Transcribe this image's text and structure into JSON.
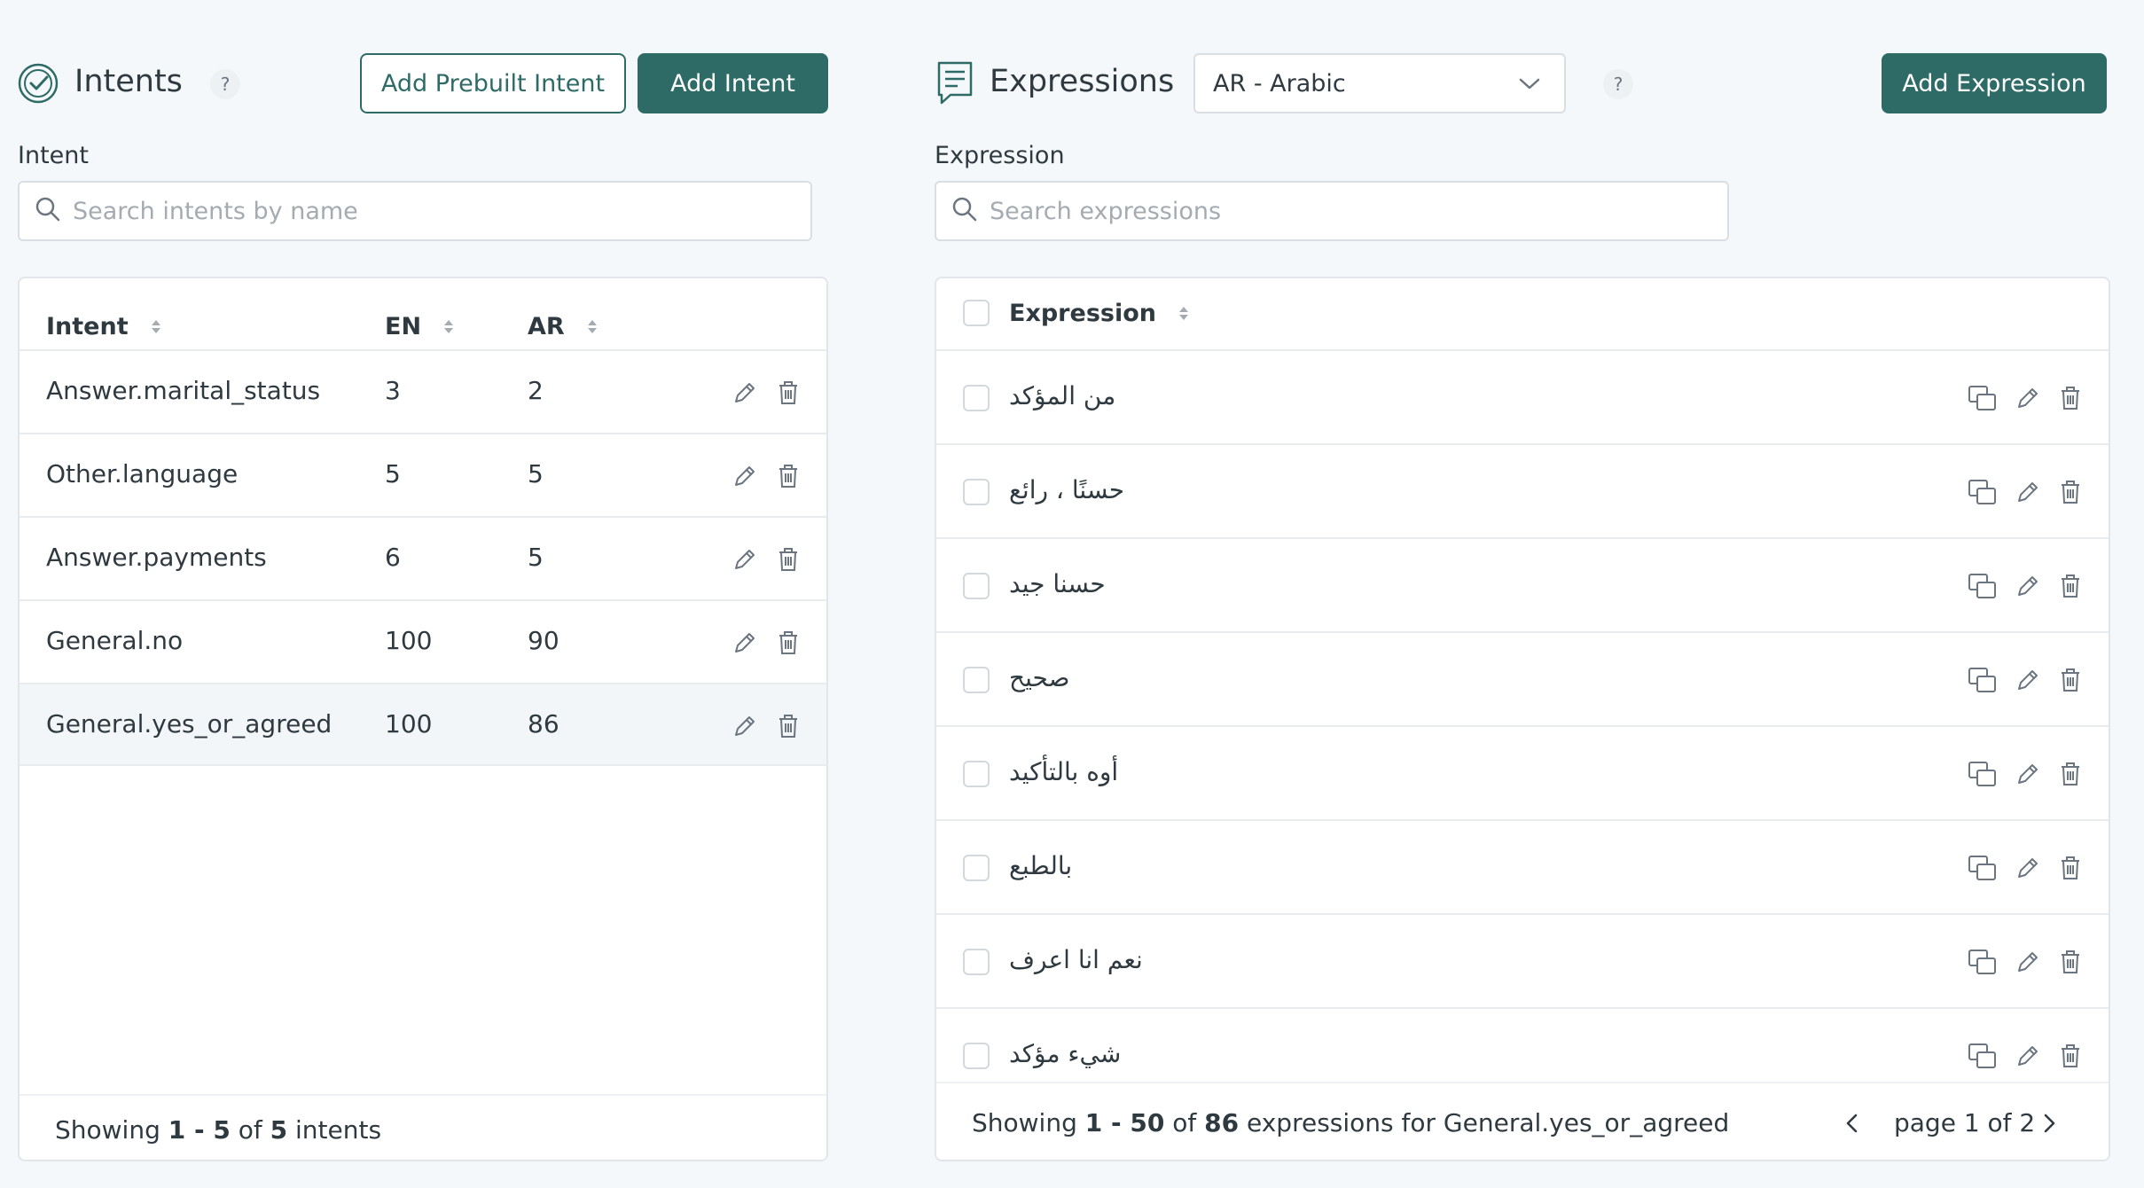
{
  "intents": {
    "title": "Intents",
    "help": "?",
    "add_prebuilt_label": "Add Prebuilt Intent",
    "add_intent_label": "Add Intent",
    "search_label": "Intent",
    "search_placeholder": "Search intents by name",
    "columns": [
      "Intent",
      "EN",
      "AR"
    ],
    "rows": [
      {
        "name": "Answer.marital_status",
        "en": "3",
        "ar": "2"
      },
      {
        "name": "Other.language",
        "en": "5",
        "ar": "5"
      },
      {
        "name": "Answer.payments",
        "en": "6",
        "ar": "5"
      },
      {
        "name": "General.no",
        "en": "100",
        "ar": "90"
      },
      {
        "name": "General.yes_or_agreed",
        "en": "100",
        "ar": "86",
        "selected": true
      }
    ],
    "footer": {
      "prefix": "Showing ",
      "range": "1 - 5",
      "of": " of ",
      "total": "5",
      "suffix": " intents"
    }
  },
  "expressions": {
    "title": "Expressions",
    "language_select": "AR - Arabic",
    "help": "?",
    "add_label": "Add Expression",
    "search_label": "Expression",
    "search_placeholder": "Search expressions",
    "column": "Expression",
    "rows": [
      "من المؤكد",
      "حسنًا ، رائع",
      "حسنا جيد",
      "صحيح",
      "أوه بالتأكيد",
      "بالطبع",
      "نعم انا اعرف",
      "شيء مؤكد"
    ],
    "footer": {
      "prefix": "Showing ",
      "range": "1 - 50",
      "of": " of ",
      "total": "86",
      "suffix": " expressions for General.yes_or_agreed"
    },
    "pagination": "page 1 of 2"
  },
  "colors": {
    "accent": "#2e6b66",
    "selected_row": "#f3f6f8"
  }
}
